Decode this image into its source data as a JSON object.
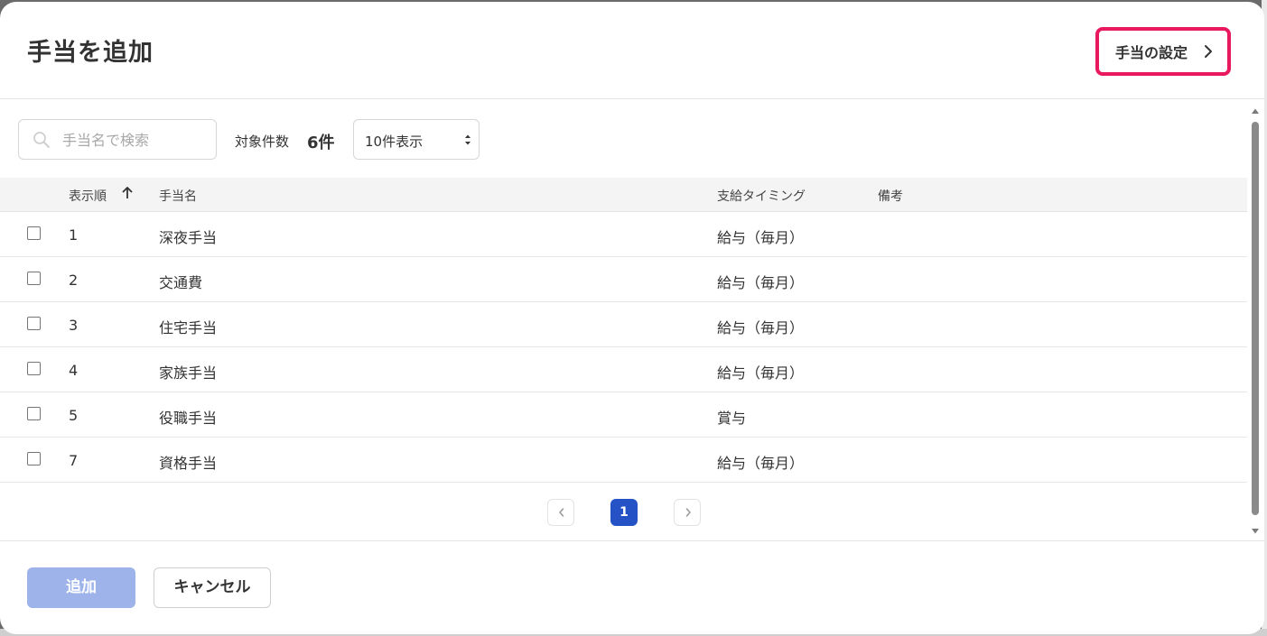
{
  "dialog": {
    "title": "手当を追加",
    "settings_link_label": "手当の設定"
  },
  "toolbar": {
    "search_placeholder": "手当名で検索",
    "count_label": "対象件数",
    "count_value": "6件",
    "page_size_selected": "10件表示"
  },
  "table": {
    "columns": {
      "order": "表示順",
      "name": "手当名",
      "timing": "支給タイミング",
      "note": "備考"
    },
    "sort": {
      "column": "order",
      "direction": "asc"
    },
    "rows": [
      {
        "order": "1",
        "name": "深夜手当",
        "timing": "給与（毎月）",
        "note": "",
        "checked": false
      },
      {
        "order": "2",
        "name": "交通費",
        "timing": "給与（毎月）",
        "note": "",
        "checked": false
      },
      {
        "order": "3",
        "name": "住宅手当",
        "timing": "給与（毎月）",
        "note": "",
        "checked": false
      },
      {
        "order": "4",
        "name": "家族手当",
        "timing": "給与（毎月）",
        "note": "",
        "checked": false
      },
      {
        "order": "5",
        "name": "役職手当",
        "timing": "賞与",
        "note": "",
        "checked": false
      },
      {
        "order": "7",
        "name": "資格手当",
        "timing": "給与（毎月）",
        "note": "",
        "checked": false
      }
    ]
  },
  "pagination": {
    "current_page": "1"
  },
  "footer": {
    "add_label": "追加",
    "cancel_label": "キャンセル"
  },
  "colors": {
    "highlight_border": "#e8195f",
    "primary": "#2553c6",
    "primary_disabled": "#9db3e9"
  },
  "icons": [
    "search-icon",
    "chevron-right-icon",
    "sort-ascending-icon",
    "select-arrows-icon",
    "chevron-left-icon",
    "scroll-up-icon",
    "scroll-down-icon"
  ]
}
